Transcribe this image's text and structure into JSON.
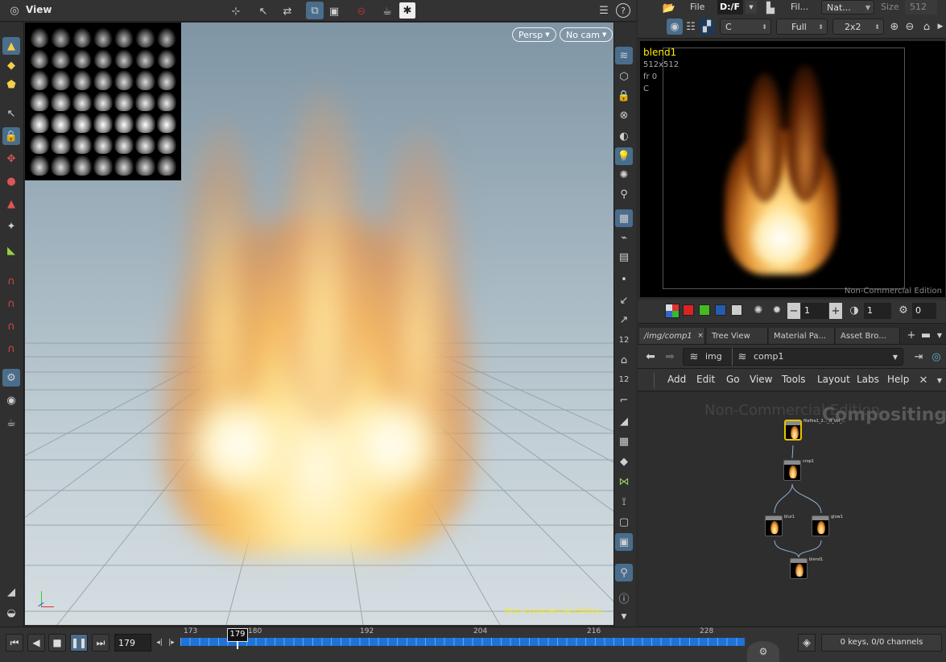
{
  "viewer": {
    "title": "View",
    "persp_label": "Persp",
    "cam_label": "No cam",
    "watermark": "Non-Commercial Edition"
  },
  "comp_viewer": {
    "menu_file": "File",
    "path_label": "D:/F",
    "menu_file2": "Fil...",
    "res_preset": "Nat...",
    "size_label": "Size",
    "size_value": "512",
    "channel": "C",
    "quality": "Full",
    "grid": "2x2",
    "node_name": "blend1",
    "res": "512x512",
    "frame": "fr 0",
    "plane": "C",
    "watermark": "Non-Commercial Edition",
    "field1": "1",
    "field2": "1",
    "field3": "0"
  },
  "network": {
    "tabs": [
      "/img/comp1",
      "Tree View",
      "Material Pa...",
      "Asset Bro..."
    ],
    "path_root": "img",
    "path_child": "comp1",
    "menu": [
      "Add",
      "Edit",
      "Go",
      "View",
      "Tools",
      "Layout",
      "Labs",
      "Help"
    ],
    "watermark": "Non-Commercial Edition",
    "context_label": "Compositing",
    "nodes": {
      "file": "filefire1_2..._d_Vol_...",
      "crop": "crop1",
      "left": "blur1",
      "right": "glow1",
      "blend": "blend1"
    }
  },
  "timeline": {
    "current_frame": "179",
    "marker_frame": "179",
    "ticks": [
      "173",
      "180",
      "192",
      "204",
      "216",
      "228"
    ],
    "keys_status": "0 keys, 0/0 channels"
  },
  "colors": {
    "accent": "#4a6d8c",
    "timeline_bar": "#1e73d8",
    "node_selected": "#e8c200",
    "label_yellow": "#ffee00"
  }
}
